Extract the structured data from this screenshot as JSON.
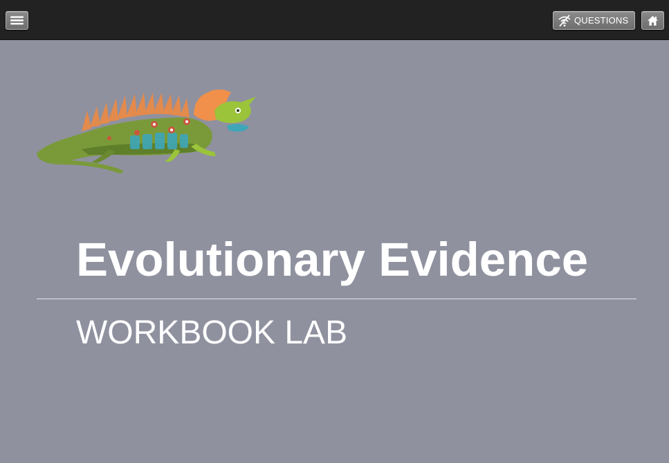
{
  "header": {
    "menu_icon": "hamburger-menu-icon",
    "questions_label": "QUESTIONS",
    "questions_icon": "wifi-off-icon",
    "home_icon": "home-icon"
  },
  "main": {
    "illustration": "lizard-illustration",
    "title": "Evolutionary Evidence",
    "subtitle": "WORKBOOK LAB"
  },
  "colors": {
    "background": "#8f919f",
    "topbar": "#222222",
    "text": "#ffffff"
  }
}
